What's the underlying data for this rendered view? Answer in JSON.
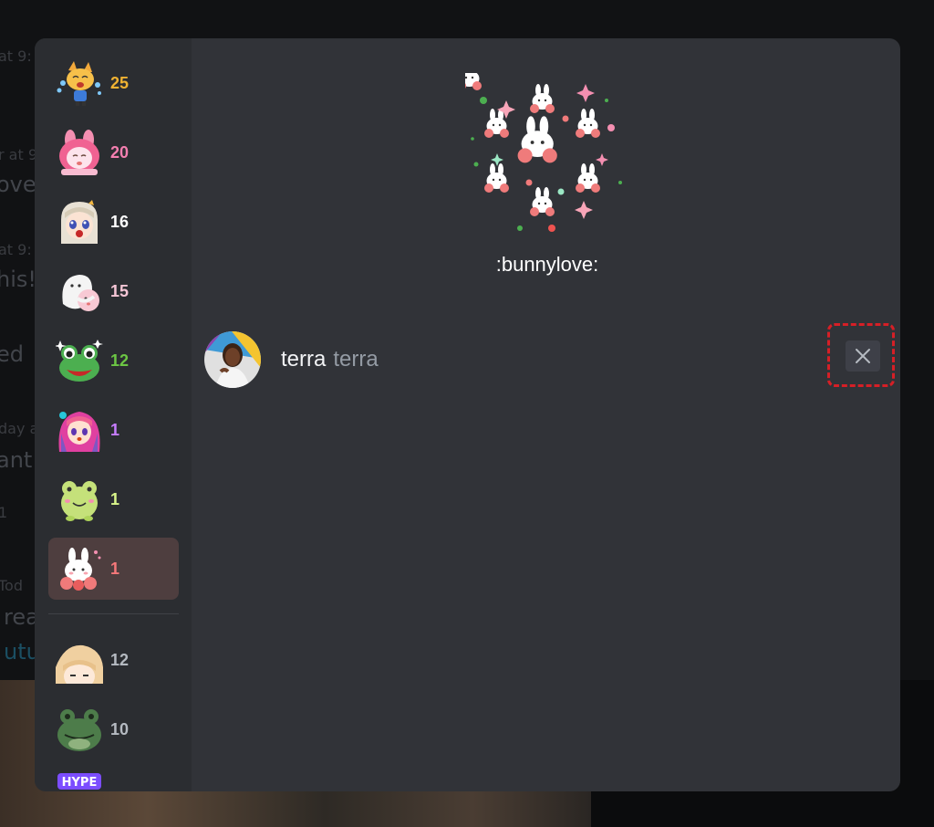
{
  "background_chat": {
    "lines": [
      {
        "text": "at 9:"
      },
      {
        "text": "r at 9"
      },
      {
        "text": "ove"
      },
      {
        "text": "at 9:"
      },
      {
        "text": "his!"
      },
      {
        "text": "ed"
      },
      {
        "text": "day a"
      },
      {
        "text": "ant"
      },
      {
        "text": "1"
      },
      {
        "text": "Tod"
      },
      {
        "text": "rea"
      },
      {
        "text": "utu"
      }
    ]
  },
  "reactions": [
    {
      "emoji": "cat-crying-emoji",
      "count": "25",
      "color": "#f0b232"
    },
    {
      "emoji": "pink-bunny-hood-emoji",
      "count": "20",
      "color": "#f47fb0"
    },
    {
      "emoji": "anime-girl-shocked-emoji",
      "count": "16",
      "color": "#ffffff"
    },
    {
      "emoji": "ghost-hug-emoji",
      "count": "15",
      "color": "#f5c6d6"
    },
    {
      "emoji": "frog-sparkle-emoji",
      "count": "12",
      "color": "#6cc644"
    },
    {
      "emoji": "anime-girl-wave-emoji",
      "count": "1",
      "color": "#c77dff"
    },
    {
      "emoji": "green-frog-emoji",
      "count": "1",
      "color": "#d9f58a"
    },
    {
      "emoji": "bunny-love-emoji",
      "count": "1",
      "color": "#f5787a",
      "selected": true
    },
    {
      "emoji": "anime-girl-peek-emoji",
      "count": "12",
      "color": "#b5bac1"
    },
    {
      "emoji": "frog-face-emoji",
      "count": "10",
      "color": "#b5bac1"
    },
    {
      "emoji": "hype-emoji",
      "count": "",
      "color": "#b5bac1"
    }
  ],
  "selected_emoji": {
    "name": ":bunnylove:",
    "icon": "bunny-love-emoji"
  },
  "users": [
    {
      "display_name": "terra",
      "username": "terra",
      "avatar": "user-avatar"
    }
  ],
  "remove_button": {
    "icon": "close-icon",
    "highlight_color": "#d61f26"
  }
}
